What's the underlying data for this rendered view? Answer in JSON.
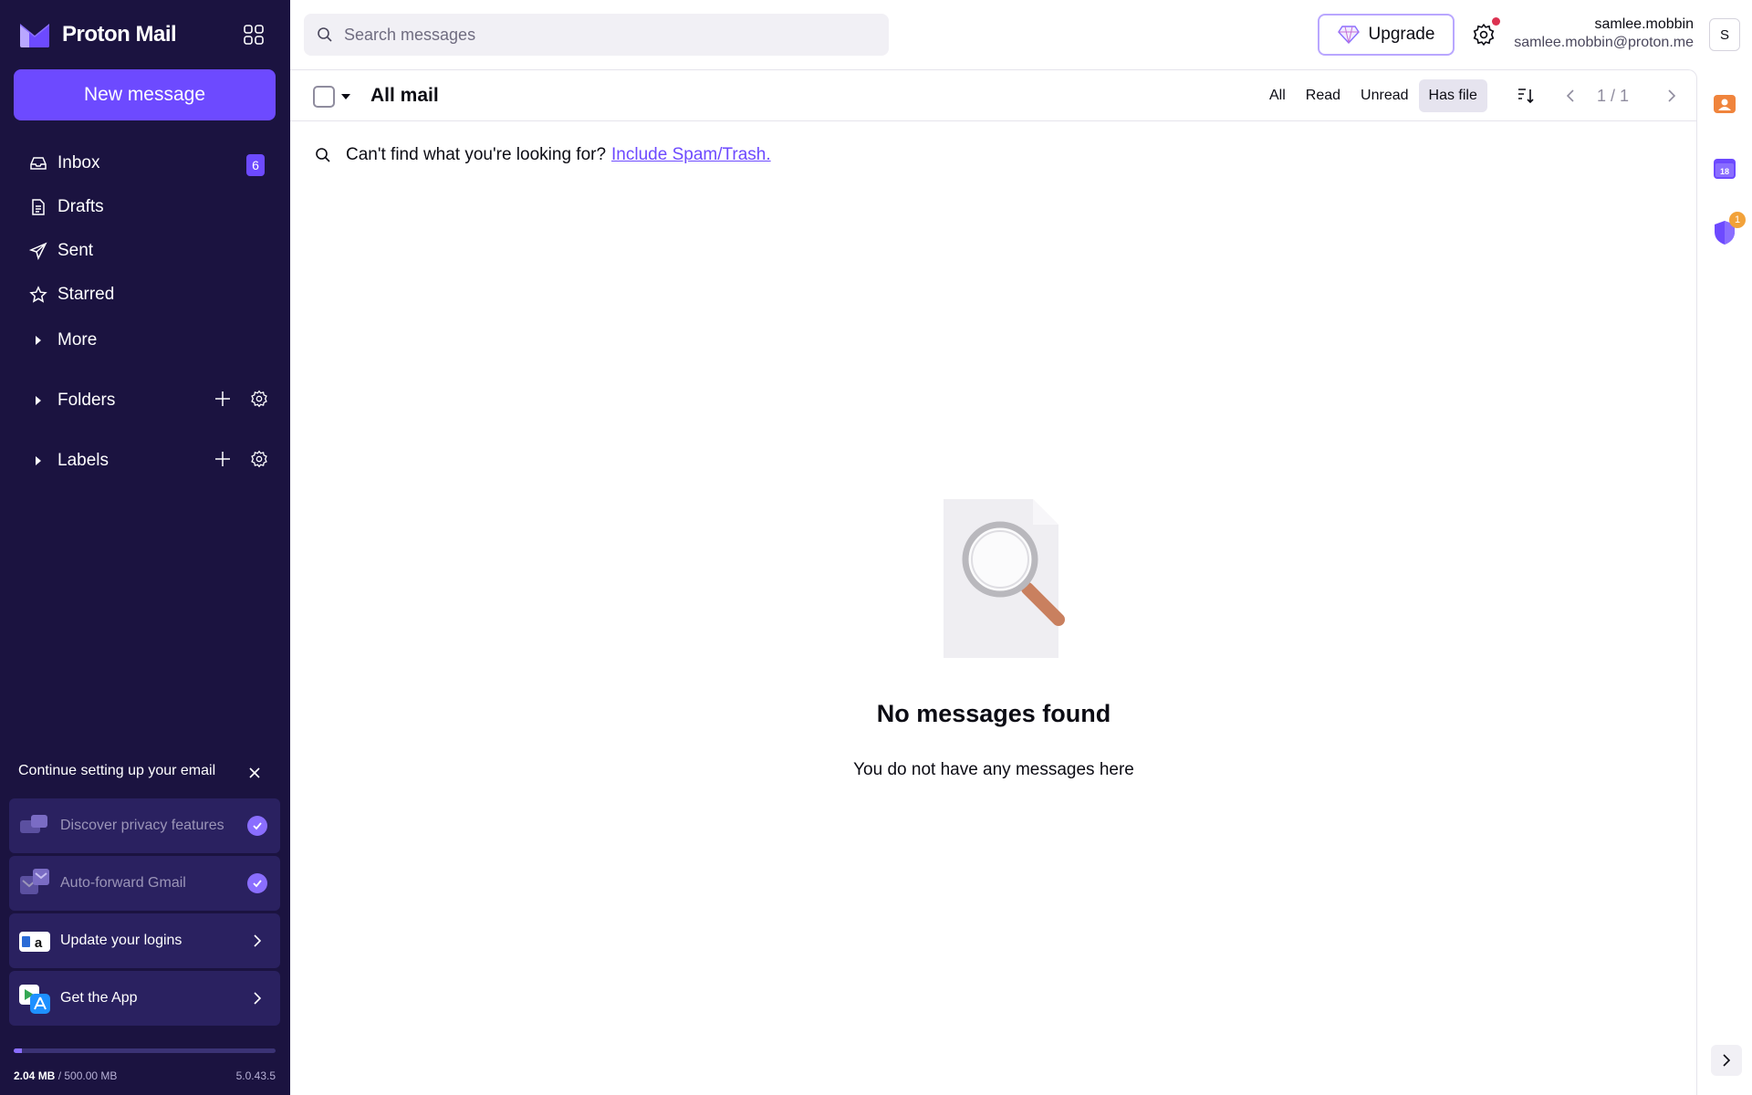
{
  "app": {
    "brand": "Proton Mail",
    "new_message": "New message"
  },
  "sidebar": {
    "items": [
      {
        "label": "Inbox",
        "icon": "inbox-icon",
        "badge": "6"
      },
      {
        "label": "Drafts",
        "icon": "drafts-icon"
      },
      {
        "label": "Sent",
        "icon": "sent-icon"
      },
      {
        "label": "Starred",
        "icon": "star-icon"
      },
      {
        "label": "More",
        "icon": "caret-right-icon"
      }
    ],
    "folders_label": "Folders",
    "labels_label": "Labels"
  },
  "setup": {
    "title": "Continue setting up your email",
    "cards": [
      {
        "label": "Discover privacy features",
        "done": true
      },
      {
        "label": "Auto-forward Gmail",
        "done": true
      },
      {
        "label": "Update your logins",
        "done": false
      },
      {
        "label": "Get the App",
        "done": false
      }
    ]
  },
  "storage": {
    "used": "2.04 MB",
    "total": "/ 500.00 MB",
    "fraction": 0.03,
    "version": "5.0.43.5"
  },
  "topbar": {
    "search_placeholder": "Search messages",
    "upgrade": "Upgrade",
    "user_name": "samlee.mobbin",
    "user_email": "samlee.mobbin@proton.me",
    "avatar_initial": "S"
  },
  "list": {
    "title": "All mail",
    "filters": [
      {
        "label": "All",
        "active": false
      },
      {
        "label": "Read",
        "active": false
      },
      {
        "label": "Unread",
        "active": false
      },
      {
        "label": "Has file",
        "active": true
      }
    ],
    "page_indicator": "1 / 1",
    "hint_text": "Can't find what you're looking for?",
    "hint_link": "Include Spam/Trash.",
    "empty_title": "No messages found",
    "empty_subtitle": "You do not have any messages here"
  },
  "rail": {
    "calendar_day": "18",
    "vpn_badge": "1"
  },
  "colors": {
    "sidebar_bg": "#1b1340",
    "accent": "#6d4aff",
    "notification": "#dc3251"
  }
}
